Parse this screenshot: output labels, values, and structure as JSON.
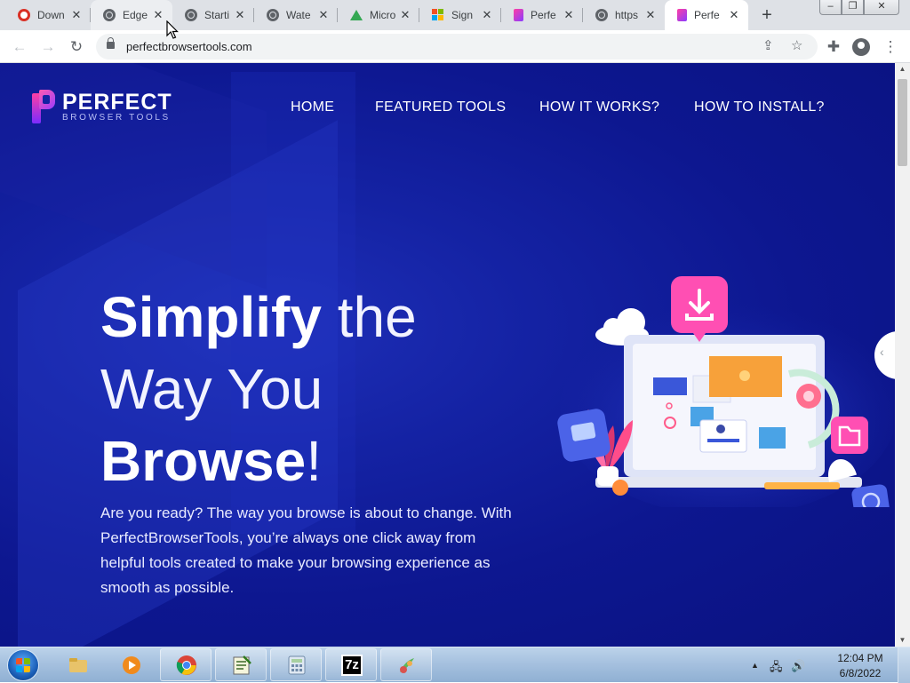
{
  "browser": {
    "tabs": [
      {
        "title": "Down",
        "icon": "target-icon",
        "active": false
      },
      {
        "title": "Edge",
        "icon": "globe-icon",
        "active": false
      },
      {
        "title": "Starti",
        "icon": "globe-icon",
        "active": false
      },
      {
        "title": "Wate",
        "icon": "globe-icon",
        "active": false
      },
      {
        "title": "Micro",
        "icon": "drive-icon",
        "active": false
      },
      {
        "title": "Sign",
        "icon": "microsoft-icon",
        "active": false
      },
      {
        "title": "Perfe",
        "icon": "perfect-logo-icon",
        "active": false
      },
      {
        "title": "https",
        "icon": "globe-icon",
        "active": false
      },
      {
        "title": "Perfe",
        "icon": "perfect-logo-icon",
        "active": true
      }
    ],
    "tab_close_glyph": "✕",
    "new_tab_glyph": "+",
    "window_buttons": {
      "minimize": "–",
      "maximize": "❐",
      "close": "✕"
    },
    "toolbar": {
      "back": "←",
      "forward": "→",
      "reload": "↻",
      "url": "perfectbrowsertools.com",
      "share": "⇪",
      "bookmark": "☆",
      "extensions": "✚",
      "menu": "⋮"
    }
  },
  "site": {
    "logo": {
      "title": "PERFECT",
      "subtitle": "BROWSER TOOLS"
    },
    "nav": [
      "HOME",
      "FEATURED TOOLS",
      "HOW IT WORKS?",
      "HOW TO INSTALL?"
    ],
    "headline": {
      "w1": "Simplify",
      "w2": " the",
      "w3": "Way You",
      "w4": "Browse",
      "w5": "!"
    },
    "lead": "Are you ready? The way you browse is about to change. With PerfectBrowserTools, you’re always one click away from helpful tools created to make your browsing experience as smooth as possible.",
    "side_tab_glyph": "‹"
  },
  "scrollbar": {
    "up": "▲",
    "down": "▼"
  },
  "taskbar": {
    "time": "12:04 PM",
    "date": "6/8/2022",
    "tray_arrow": "▲",
    "tray_network": "🖧",
    "tray_volume": "🔊",
    "apps": [
      "explorer-icon",
      "media-player-icon",
      "chrome-icon",
      "notepad-icon",
      "calculator-icon",
      "7zip-icon",
      "fruit-icon"
    ],
    "sevenzip_label": "7z"
  },
  "colors": {
    "page_bg": "#1422a3",
    "accent_pink": "#ff3fa4",
    "accent_purple": "#8a3cff"
  }
}
